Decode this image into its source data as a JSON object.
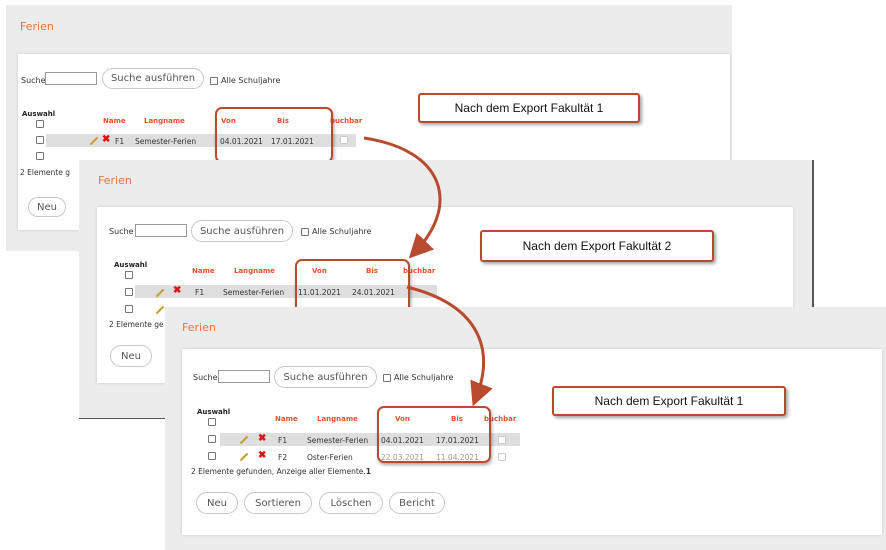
{
  "title": "Ferien",
  "search": {
    "label": "Suche",
    "button": "Suche ausführen",
    "all_years": "Alle Schuljahre"
  },
  "columns": {
    "auswahl": "Auswahl",
    "name": "Name",
    "langname": "Langname",
    "von": "Von",
    "bis": "Bis",
    "buchbar": "buchbar"
  },
  "panel1": {
    "callout": "Nach dem Export Fakultät 1",
    "row1": {
      "name": "F1",
      "langname": "Semester-Ferien",
      "von": "04.01.2021",
      "bis": "17.01.2021"
    },
    "footer_partial": "2 Elemente g",
    "new_button": "Neu"
  },
  "panel2": {
    "callout": "Nach dem Export Fakultät 2",
    "row1": {
      "name": "F1",
      "langname": "Semester-Ferien",
      "von": "11.01.2021",
      "bis": "24.01.2021"
    },
    "footer_partial": "2 Elemente ge",
    "new_button": "Neu"
  },
  "panel3": {
    "callout": "Nach dem Export Fakultät 1",
    "row1": {
      "name": "F1",
      "langname": "Semester-Ferien",
      "von": "04.01.2021",
      "bis": "17.01.2021"
    },
    "row2": {
      "name": "F2",
      "langname": "Oster-Ferien",
      "von": "22.03.2021",
      "bis": "11.04.2021"
    },
    "footer_text": "2 Elemente gefunden, Anzeige aller Elemente.",
    "footer_count": "1",
    "buttons": {
      "neu": "Neu",
      "sortieren": "Sortieren",
      "loeschen": "Löschen",
      "bericht": "Bericht"
    }
  },
  "colors": {
    "accent": "#e8743b",
    "header": "#e8502a",
    "highlight": "#b84a2e"
  }
}
